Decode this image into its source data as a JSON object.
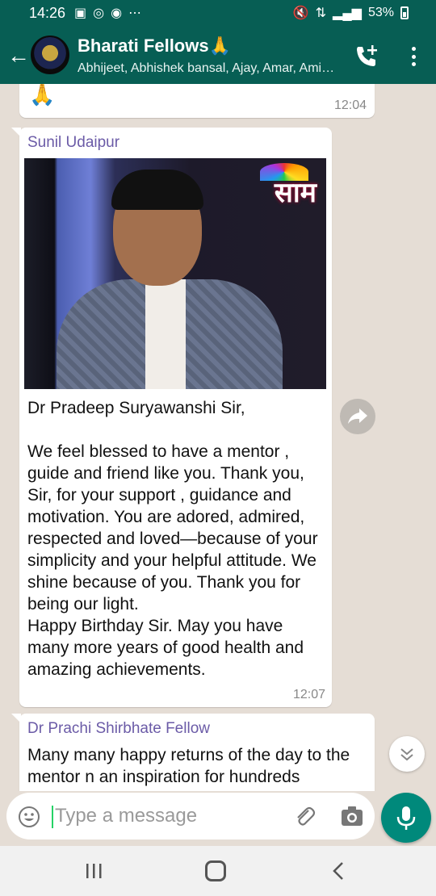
{
  "status_bar": {
    "time": "14:26",
    "battery": "53%",
    "left_icons": [
      "gallery-icon",
      "whatsapp-icon",
      "chrome-icon",
      "more-notifications-icon"
    ]
  },
  "header": {
    "title": "Bharati Fellows🙏",
    "members": "Abhijeet, Abhishek bansal, Ajay, Amar, Ami…",
    "accent_color": "#075e54"
  },
  "messages": [
    {
      "content": "🙏",
      "time": "12:04"
    },
    {
      "sender": "Sunil Udaipur",
      "sender_color": "#6b5ba7",
      "image_logo": "साम",
      "text": "Dr Pradeep Suryawanshi Sir,\n\nWe feel blessed to have a mentor , guide and friend like you. Thank you, Sir, for your support , guidance and motivation. You are adored, admired, respected and loved—because of your simplicity and your helpful attitude. We shine because of you. Thank you for being our light.\nHappy Birthday Sir. May you have many more years of good health and amazing achievements.",
      "time": "12:07"
    },
    {
      "sender": "Dr Prachi Shirbhate Fellow",
      "sender_color": "#6b5ba7",
      "text": "Many many happy returns of the day to the mentor n an inspiration for hundreds"
    }
  ],
  "composer": {
    "placeholder": "Type a message",
    "mic_color": "#00897b"
  }
}
